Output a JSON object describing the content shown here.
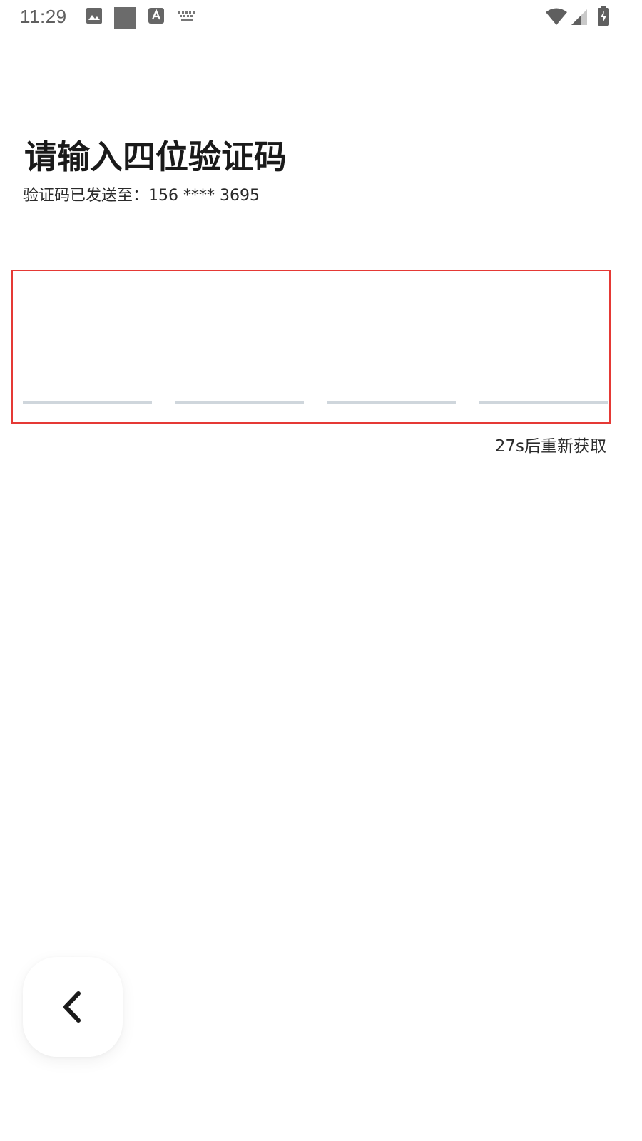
{
  "status_bar": {
    "time": "11:29",
    "left_icons": [
      "image-icon",
      "square-icon",
      "text-a-icon",
      "keyboard-icon"
    ],
    "right_icons": [
      "wifi-icon",
      "signal-icon",
      "battery-charging-icon"
    ]
  },
  "page": {
    "title": "请输入四位验证码",
    "subtitle": "验证码已发送至：156 **** 3695",
    "otp_length": 4,
    "otp_values": [
      "",
      "",
      "",
      ""
    ],
    "resend_label": "27s后重新获取",
    "back_icon": "chevron-left-icon"
  },
  "colors": {
    "highlight_border": "#e53935",
    "otp_underline": "#cfd6dc",
    "text_primary": "#1a1a1a",
    "status_text": "#5f5f5f"
  }
}
